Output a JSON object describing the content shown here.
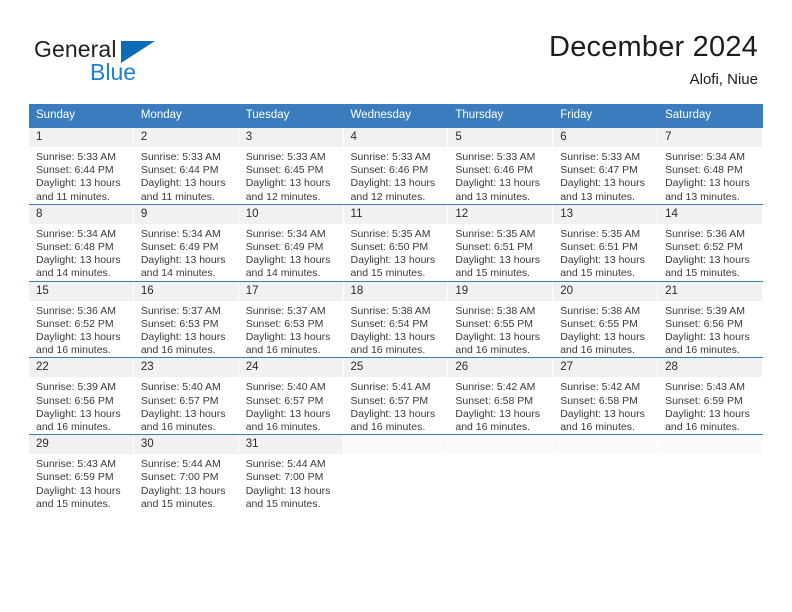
{
  "brand": {
    "name_part1": "General",
    "name_part2": "Blue",
    "logo_icon": "blue-triangle-icon",
    "color_dark": "#231f20",
    "color_blue": "#1b7fd4"
  },
  "header": {
    "title": "December 2024",
    "subtitle": "Alofi, Niue"
  },
  "colors": {
    "header_row": "#3a7cbe",
    "header_text": "#ffffff",
    "daynum_bg": "#f1f1f1",
    "grid_line": "#3a7cbe"
  },
  "weekday_headers": [
    "Sunday",
    "Monday",
    "Tuesday",
    "Wednesday",
    "Thursday",
    "Friday",
    "Saturday"
  ],
  "weeks": [
    [
      {
        "day": "1",
        "sunrise": "Sunrise: 5:33 AM",
        "sunset": "Sunset: 6:44 PM",
        "daylight_line1": "Daylight: 13 hours",
        "daylight_line2": "and 11 minutes."
      },
      {
        "day": "2",
        "sunrise": "Sunrise: 5:33 AM",
        "sunset": "Sunset: 6:44 PM",
        "daylight_line1": "Daylight: 13 hours",
        "daylight_line2": "and 11 minutes."
      },
      {
        "day": "3",
        "sunrise": "Sunrise: 5:33 AM",
        "sunset": "Sunset: 6:45 PM",
        "daylight_line1": "Daylight: 13 hours",
        "daylight_line2": "and 12 minutes."
      },
      {
        "day": "4",
        "sunrise": "Sunrise: 5:33 AM",
        "sunset": "Sunset: 6:46 PM",
        "daylight_line1": "Daylight: 13 hours",
        "daylight_line2": "and 12 minutes."
      },
      {
        "day": "5",
        "sunrise": "Sunrise: 5:33 AM",
        "sunset": "Sunset: 6:46 PM",
        "daylight_line1": "Daylight: 13 hours",
        "daylight_line2": "and 13 minutes."
      },
      {
        "day": "6",
        "sunrise": "Sunrise: 5:33 AM",
        "sunset": "Sunset: 6:47 PM",
        "daylight_line1": "Daylight: 13 hours",
        "daylight_line2": "and 13 minutes."
      },
      {
        "day": "7",
        "sunrise": "Sunrise: 5:34 AM",
        "sunset": "Sunset: 6:48 PM",
        "daylight_line1": "Daylight: 13 hours",
        "daylight_line2": "and 13 minutes."
      }
    ],
    [
      {
        "day": "8",
        "sunrise": "Sunrise: 5:34 AM",
        "sunset": "Sunset: 6:48 PM",
        "daylight_line1": "Daylight: 13 hours",
        "daylight_line2": "and 14 minutes."
      },
      {
        "day": "9",
        "sunrise": "Sunrise: 5:34 AM",
        "sunset": "Sunset: 6:49 PM",
        "daylight_line1": "Daylight: 13 hours",
        "daylight_line2": "and 14 minutes."
      },
      {
        "day": "10",
        "sunrise": "Sunrise: 5:34 AM",
        "sunset": "Sunset: 6:49 PM",
        "daylight_line1": "Daylight: 13 hours",
        "daylight_line2": "and 14 minutes."
      },
      {
        "day": "11",
        "sunrise": "Sunrise: 5:35 AM",
        "sunset": "Sunset: 6:50 PM",
        "daylight_line1": "Daylight: 13 hours",
        "daylight_line2": "and 15 minutes."
      },
      {
        "day": "12",
        "sunrise": "Sunrise: 5:35 AM",
        "sunset": "Sunset: 6:51 PM",
        "daylight_line1": "Daylight: 13 hours",
        "daylight_line2": "and 15 minutes."
      },
      {
        "day": "13",
        "sunrise": "Sunrise: 5:35 AM",
        "sunset": "Sunset: 6:51 PM",
        "daylight_line1": "Daylight: 13 hours",
        "daylight_line2": "and 15 minutes."
      },
      {
        "day": "14",
        "sunrise": "Sunrise: 5:36 AM",
        "sunset": "Sunset: 6:52 PM",
        "daylight_line1": "Daylight: 13 hours",
        "daylight_line2": "and 15 minutes."
      }
    ],
    [
      {
        "day": "15",
        "sunrise": "Sunrise: 5:36 AM",
        "sunset": "Sunset: 6:52 PM",
        "daylight_line1": "Daylight: 13 hours",
        "daylight_line2": "and 16 minutes."
      },
      {
        "day": "16",
        "sunrise": "Sunrise: 5:37 AM",
        "sunset": "Sunset: 6:53 PM",
        "daylight_line1": "Daylight: 13 hours",
        "daylight_line2": "and 16 minutes."
      },
      {
        "day": "17",
        "sunrise": "Sunrise: 5:37 AM",
        "sunset": "Sunset: 6:53 PM",
        "daylight_line1": "Daylight: 13 hours",
        "daylight_line2": "and 16 minutes."
      },
      {
        "day": "18",
        "sunrise": "Sunrise: 5:38 AM",
        "sunset": "Sunset: 6:54 PM",
        "daylight_line1": "Daylight: 13 hours",
        "daylight_line2": "and 16 minutes."
      },
      {
        "day": "19",
        "sunrise": "Sunrise: 5:38 AM",
        "sunset": "Sunset: 6:55 PM",
        "daylight_line1": "Daylight: 13 hours",
        "daylight_line2": "and 16 minutes."
      },
      {
        "day": "20",
        "sunrise": "Sunrise: 5:38 AM",
        "sunset": "Sunset: 6:55 PM",
        "daylight_line1": "Daylight: 13 hours",
        "daylight_line2": "and 16 minutes."
      },
      {
        "day": "21",
        "sunrise": "Sunrise: 5:39 AM",
        "sunset": "Sunset: 6:56 PM",
        "daylight_line1": "Daylight: 13 hours",
        "daylight_line2": "and 16 minutes."
      }
    ],
    [
      {
        "day": "22",
        "sunrise": "Sunrise: 5:39 AM",
        "sunset": "Sunset: 6:56 PM",
        "daylight_line1": "Daylight: 13 hours",
        "daylight_line2": "and 16 minutes."
      },
      {
        "day": "23",
        "sunrise": "Sunrise: 5:40 AM",
        "sunset": "Sunset: 6:57 PM",
        "daylight_line1": "Daylight: 13 hours",
        "daylight_line2": "and 16 minutes."
      },
      {
        "day": "24",
        "sunrise": "Sunrise: 5:40 AM",
        "sunset": "Sunset: 6:57 PM",
        "daylight_line1": "Daylight: 13 hours",
        "daylight_line2": "and 16 minutes."
      },
      {
        "day": "25",
        "sunrise": "Sunrise: 5:41 AM",
        "sunset": "Sunset: 6:57 PM",
        "daylight_line1": "Daylight: 13 hours",
        "daylight_line2": "and 16 minutes."
      },
      {
        "day": "26",
        "sunrise": "Sunrise: 5:42 AM",
        "sunset": "Sunset: 6:58 PM",
        "daylight_line1": "Daylight: 13 hours",
        "daylight_line2": "and 16 minutes."
      },
      {
        "day": "27",
        "sunrise": "Sunrise: 5:42 AM",
        "sunset": "Sunset: 6:58 PM",
        "daylight_line1": "Daylight: 13 hours",
        "daylight_line2": "and 16 minutes."
      },
      {
        "day": "28",
        "sunrise": "Sunrise: 5:43 AM",
        "sunset": "Sunset: 6:59 PM",
        "daylight_line1": "Daylight: 13 hours",
        "daylight_line2": "and 16 minutes."
      }
    ],
    [
      {
        "day": "29",
        "sunrise": "Sunrise: 5:43 AM",
        "sunset": "Sunset: 6:59 PM",
        "daylight_line1": "Daylight: 13 hours",
        "daylight_line2": "and 15 minutes."
      },
      {
        "day": "30",
        "sunrise": "Sunrise: 5:44 AM",
        "sunset": "Sunset: 7:00 PM",
        "daylight_line1": "Daylight: 13 hours",
        "daylight_line2": "and 15 minutes."
      },
      {
        "day": "31",
        "sunrise": "Sunrise: 5:44 AM",
        "sunset": "Sunset: 7:00 PM",
        "daylight_line1": "Daylight: 13 hours",
        "daylight_line2": "and 15 minutes."
      },
      {
        "day": "",
        "sunrise": "",
        "sunset": "",
        "daylight_line1": "",
        "daylight_line2": ""
      },
      {
        "day": "",
        "sunrise": "",
        "sunset": "",
        "daylight_line1": "",
        "daylight_line2": ""
      },
      {
        "day": "",
        "sunrise": "",
        "sunset": "",
        "daylight_line1": "",
        "daylight_line2": ""
      },
      {
        "day": "",
        "sunrise": "",
        "sunset": "",
        "daylight_line1": "",
        "daylight_line2": ""
      }
    ]
  ]
}
